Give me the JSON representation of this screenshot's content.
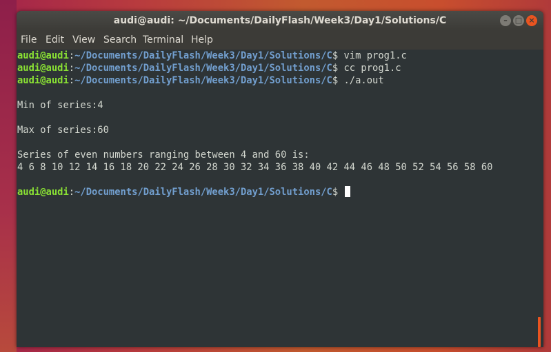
{
  "window": {
    "title": "audi@audi: ~/Documents/DailyFlash/Week3/Day1/Solutions/C",
    "controls": {
      "minimize": "–",
      "maximize": "□",
      "close": "×"
    }
  },
  "menu": {
    "file": "File",
    "edit": "Edit",
    "view": "View",
    "search": "Search",
    "terminal": "Terminal",
    "help": "Help"
  },
  "prompt": {
    "user": "audi@audi",
    "sep": ":",
    "path": "~/Documents/DailyFlash/Week3/Day1/Solutions/C",
    "symbol": "$"
  },
  "terminal": {
    "commands": [
      " vim prog1.c",
      " cc prog1.c",
      " ./a.out"
    ],
    "output": {
      "min": "Min of series:4",
      "max": "Max of series:60",
      "heading": "Series of even numbers ranging between 4 and 60 is:",
      "series": "4 6 8 10 12 14 16 18 20 22 24 26 28 30 32 34 36 38 40 42 44 46 48 50 52 54 56 58 60"
    }
  },
  "colors": {
    "accent": "#e95420",
    "prompt_user": "#8ae234",
    "prompt_path": "#729fcf",
    "terminal_bg": "#2e3436",
    "text": "#d3d7cf"
  }
}
